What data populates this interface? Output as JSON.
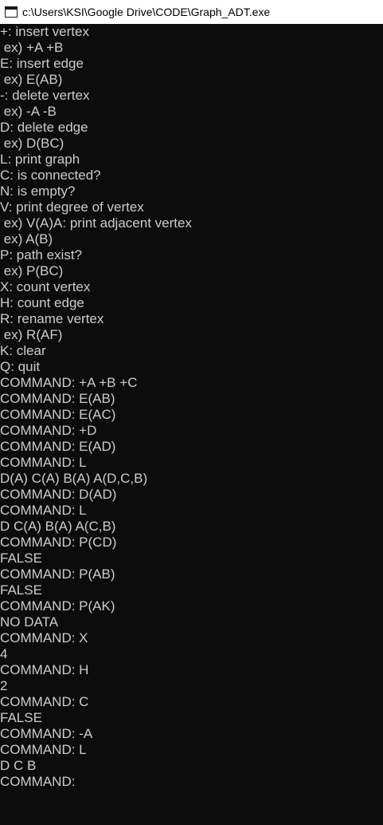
{
  "window": {
    "title": "c:\\Users\\KSI\\Google Drive\\CODE\\Graph_ADT.exe"
  },
  "console": {
    "lines": [
      "+: insert vertex",
      " ex) +A +B",
      "E: insert edge",
      " ex) E(AB)",
      "-: delete vertex",
      " ex) -A -B",
      "D: delete edge",
      " ex) D(BC)",
      "L: print graph",
      "C: is connected?",
      "N: is empty?",
      "V: print degree of vertex",
      " ex) V(A)A: print adjacent vertex",
      " ex) A(B)",
      "P: path exist?",
      " ex) P(BC)",
      "X: count vertex",
      "H: count edge",
      "R: rename vertex",
      " ex) R(AF)",
      "K: clear",
      "Q: quit",
      "COMMAND: +A +B +C",
      "COMMAND: E(AB)",
      "COMMAND: E(AC)",
      "COMMAND: +D",
      "COMMAND: E(AD)",
      "COMMAND: L",
      "D(A) C(A) B(A) A(D,C,B)",
      "COMMAND: D(AD)",
      "COMMAND: L",
      "D C(A) B(A) A(C,B)",
      "COMMAND: P(CD)",
      "FALSE",
      "COMMAND: P(AB)",
      "FALSE",
      "COMMAND: P(AK)",
      "NO DATA",
      "COMMAND: X",
      "4",
      "COMMAND: H",
      "2",
      "COMMAND: C",
      "FALSE",
      "COMMAND: -A",
      "COMMAND: L",
      "D C B",
      "COMMAND:"
    ]
  }
}
